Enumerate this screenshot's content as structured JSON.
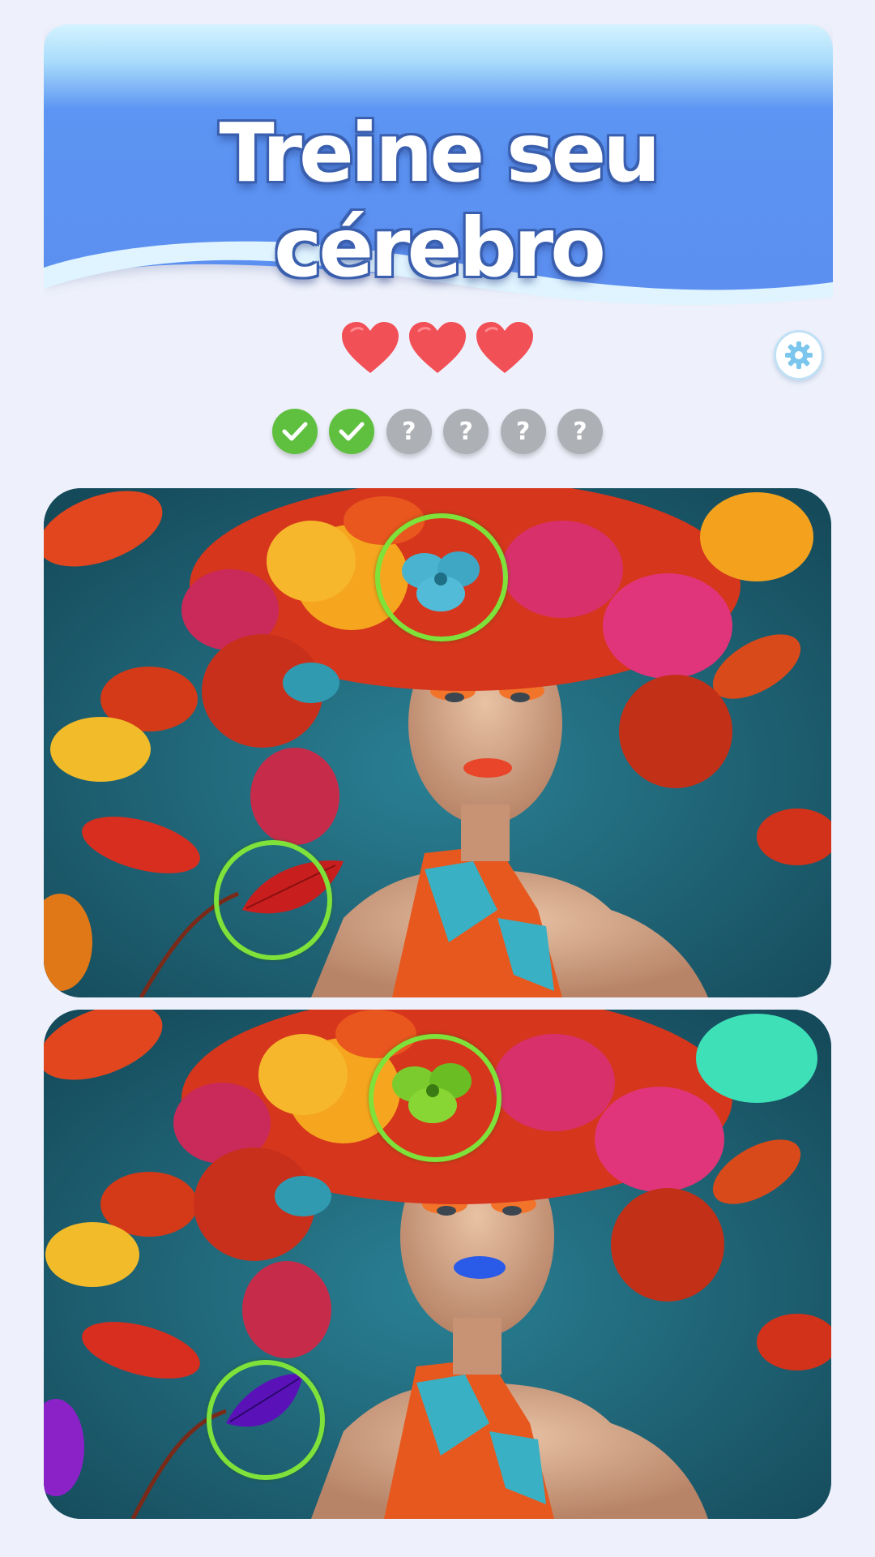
{
  "banner": {
    "title": "Treine seu cérebro"
  },
  "lives": {
    "count": 3,
    "icon": "heart-icon",
    "color": "#f15058"
  },
  "settings": {
    "icon": "gear-icon"
  },
  "progress": {
    "found": 2,
    "total": 6,
    "items": [
      {
        "state": "found",
        "icon": "check-icon"
      },
      {
        "state": "found",
        "icon": "check-icon"
      },
      {
        "state": "pending",
        "label": "?"
      },
      {
        "state": "pending",
        "label": "?"
      },
      {
        "state": "pending",
        "label": "?"
      },
      {
        "state": "pending",
        "label": "?"
      }
    ]
  },
  "puzzle": {
    "original_image": "woman-with-flower-hat-original",
    "modified_image": "woman-with-flower-hat-modified",
    "differences_marked": [
      {
        "name": "hat-flower",
        "top_color": "#4ab4d0",
        "bottom_color": "#7ccb2e"
      },
      {
        "name": "leaf",
        "top_color": "#c81e1e",
        "bottom_color": "#5a12b8"
      }
    ],
    "marker_color": "#7ee23a"
  },
  "colors": {
    "background": "#eef1fb",
    "banner_top": "#cdeefe",
    "banner_main": "#5b93f3",
    "found_dot": "#5fbf3f",
    "pending_dot": "#adb0b5",
    "backdrop_teal": "#1d5c6e"
  }
}
